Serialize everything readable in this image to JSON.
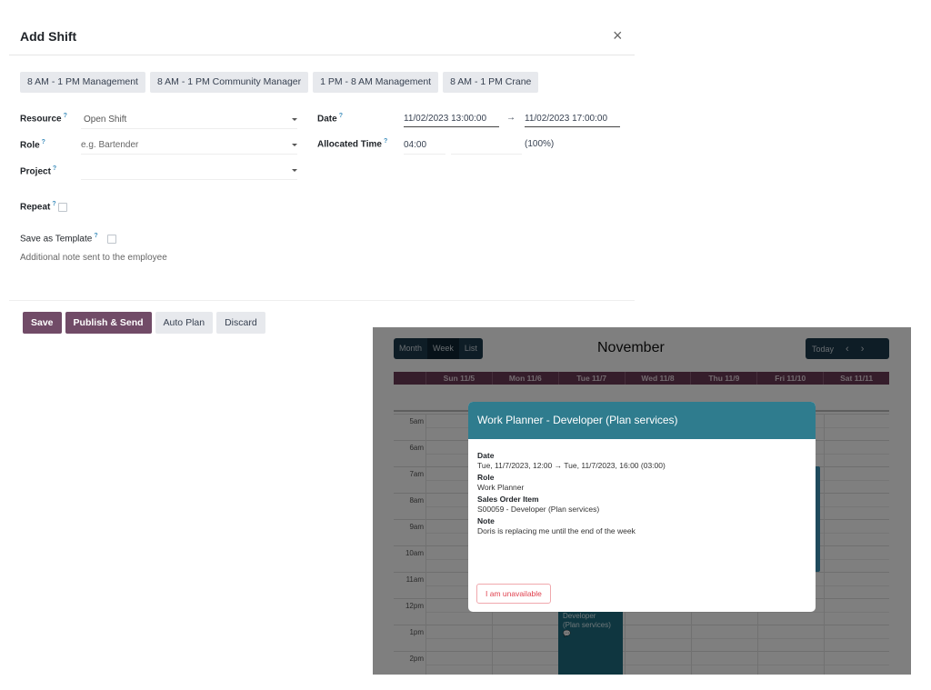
{
  "dialog": {
    "title": "Add Shift",
    "close_icon": "×",
    "templates": [
      "8 AM - 1 PM Management",
      "8 AM - 1 PM Community Manager",
      "1 PM - 8 AM Management",
      "8 AM - 1 PM Crane"
    ],
    "help_mark": "?",
    "fields": {
      "resource": {
        "label": "Resource",
        "value": "Open Shift"
      },
      "role": {
        "label": "Role",
        "placeholder": "e.g. Bartender",
        "value": ""
      },
      "project": {
        "label": "Project",
        "value": ""
      },
      "date": {
        "label": "Date",
        "start": "11/02/2023  13:00:00",
        "arrow": "→",
        "end": "11/02/2023  17:00:00"
      },
      "allocated_time": {
        "label": "Allocated Time",
        "value": "04:00",
        "percent": "(100%)"
      },
      "repeat": {
        "label": "Repeat",
        "checked": false
      },
      "save_as_template": {
        "label": "Save as Template",
        "checked": false
      },
      "note": {
        "placeholder": "Additional note sent to the employee"
      }
    },
    "actions": {
      "save": "Save",
      "publish_send": "Publish & Send",
      "auto_plan": "Auto Plan",
      "discard": "Discard"
    }
  },
  "calendar": {
    "views": [
      "Month",
      "Week",
      "List"
    ],
    "active_view": "Week",
    "month": "November",
    "today": "Today",
    "prev_icon": "‹",
    "next_icon": "›",
    "days": [
      "Sun 11/5",
      "Mon 11/6",
      "Tue 11/7",
      "Wed 11/8",
      "Thu 11/9",
      "Fri 11/10",
      "Sat 11/11"
    ],
    "hours": [
      "5am",
      "6am",
      "7am",
      "8am",
      "9am",
      "10am",
      "11am",
      "12pm",
      "1pm",
      "2pm"
    ],
    "event": {
      "title": "Work Planner - Developer (Plan services)",
      "lines": [
        "Work Planner -",
        "Developer",
        "(Plan services)"
      ],
      "comment_icon": "💬"
    },
    "popover": {
      "title": "Work Planner - Developer (Plan services)",
      "date_label": "Date",
      "date_value": "Tue, 11/7/2023, 12:00 → Tue, 11/7/2023, 16:00 (03:00)",
      "role_label": "Role",
      "role_value": "Work Planner",
      "soi_label": "Sales Order Item",
      "soi_value": "S00059 - Developer (Plan services)",
      "note_label": "Note",
      "note_value": "Doris is replacing me until the end of the week",
      "unavailable_button": "I am unavailable"
    }
  },
  "colors": {
    "primary": "#714b67",
    "secondary_btn": "#e7e9ed",
    "calendar_header": "#6b3b57",
    "popover_header": "#2f7c8e",
    "danger": "#e0424f"
  }
}
